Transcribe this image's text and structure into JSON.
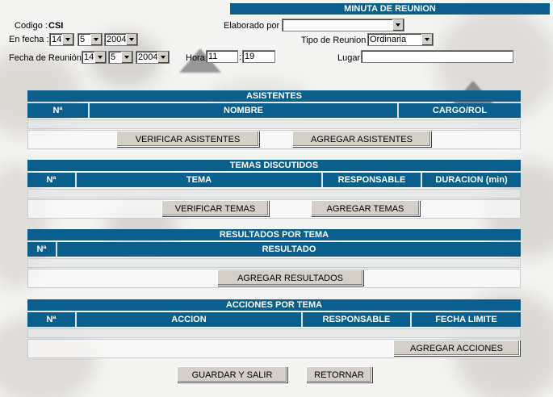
{
  "header": {
    "title": "MINUTA DE REUNION"
  },
  "form": {
    "codigo_label": "Codigo :",
    "codigo_value": "CSI",
    "elaborado_label": "Elaborado por :",
    "elaborado_value": "",
    "en_fecha_label": "En fecha :",
    "en_fecha": {
      "day": "14",
      "month": "5",
      "year": "2004"
    },
    "tipo_label": "Tipo de Reunion :",
    "tipo_value": "Ordinaria",
    "fecha_reunion_label": "Fecha de Reunión:",
    "fecha_reunion": {
      "day": "14",
      "month": "5",
      "year": "2004"
    },
    "hora_label": "Hora:",
    "hora_h": "11",
    "hora_sep": ":",
    "hora_m": "19",
    "lugar_label": "Lugar:",
    "lugar_value": ""
  },
  "asistentes": {
    "title": "ASISTENTES",
    "columns": [
      "Nª",
      "NOMBRE",
      "CARGO/ROL"
    ],
    "verify_button": "VERIFICAR ASISTENTES",
    "add_button": "AGREGAR ASISTENTES"
  },
  "temas": {
    "title": "TEMAS DISCUTIDOS",
    "columns": [
      "Nª",
      "TEMA",
      "RESPONSABLE",
      "DURACION (min)"
    ],
    "verify_button": "VERIFICAR TEMAS",
    "add_button": "AGREGAR TEMAS"
  },
  "resultados": {
    "title": "RESULTADOS POR TEMA",
    "columns": [
      "Nª",
      "RESULTADO"
    ],
    "add_button": "AGREGAR RESULTADOS"
  },
  "acciones": {
    "title": "ACCIONES POR TEMA",
    "columns": [
      "Nª",
      "ACCION",
      "RESPONSABLE",
      "FECHA LIMITE"
    ],
    "add_button": "AGREGAR ACCIONES"
  },
  "footer": {
    "save_button": "GUARDAR Y SALIR",
    "back_button": "RETORNAR"
  }
}
